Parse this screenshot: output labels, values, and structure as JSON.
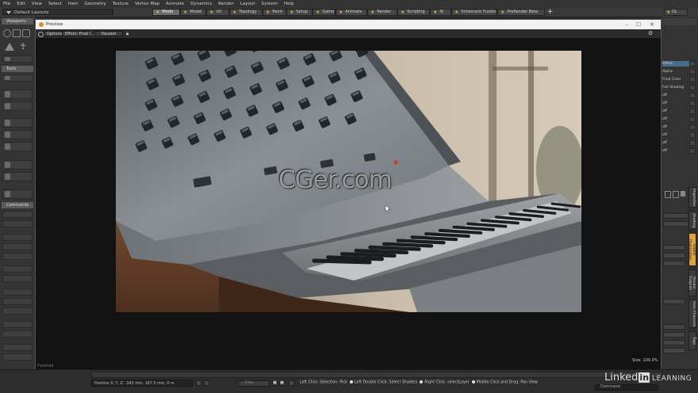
{
  "menu": [
    "File",
    "Edit",
    "View",
    "Select",
    "Item",
    "Geometry",
    "Texture",
    "Vertex Map",
    "Animate",
    "Dynamics",
    "Render",
    "Layout",
    "System",
    "Help"
  ],
  "layout_selector": "Default Layouts",
  "tabs": [
    {
      "label": "Modo",
      "active": true
    },
    {
      "label": "Model",
      "active": false
    },
    {
      "label": "UV",
      "active": false
    },
    {
      "label": "Topology",
      "active": false
    },
    {
      "label": "Paint",
      "active": false
    },
    {
      "label": "Setup",
      "active": false
    },
    {
      "label": "Game",
      "active": false
    },
    {
      "label": "Animate",
      "active": false
    },
    {
      "label": "Render",
      "active": false
    },
    {
      "label": "Scripting",
      "active": false
    },
    {
      "label": "IK",
      "active": false
    },
    {
      "label": "Schematic Fusion",
      "active": false
    },
    {
      "label": "ProRender Beta",
      "active": false
    }
  ],
  "tab_add": "+",
  "gl_button": "GL",
  "left_panel": {
    "viewports_label": "Viewports",
    "tools_label": "Tools",
    "commands_label": "Commands"
  },
  "right_panel": {
    "rows": [
      "Effect",
      "Alpha",
      "Final Color",
      "Full Shading",
      "off",
      "off",
      "off",
      "off",
      "off",
      "off",
      "off",
      "off"
    ],
    "vertical_tabs": [
      "Properties",
      "Shading",
      "Global Illumination",
      "Render Outputs",
      "Item Channels",
      "Tags"
    ]
  },
  "preview": {
    "title": "Preview",
    "toolbar": {
      "options": "Options",
      "effect": "Effect: Final C...",
      "status": "Paused"
    },
    "window_buttons": {
      "minimize": "–",
      "maximize": "☐",
      "close": "✕"
    },
    "size_label": "Size: 100.0%",
    "frame_label": "Finished"
  },
  "watermark": "CGer.com",
  "statusbar": {
    "position": "Position X, Y, Z:   -343 mm, 167.5 mm, 0 m",
    "slider_label": "Filter",
    "hints": [
      "Left Click: Selection: Pick",
      "Left Double Click: Select Shaders",
      "Right Click: selectLayer",
      "Middle Click and Drag: Pan View"
    ],
    "command_placeholder": "Command"
  },
  "branding": {
    "linked": "Linked",
    "in": "in",
    "learning": "LEARNING"
  },
  "colors": {
    "accent_star": "#e2b23a",
    "active_tab": "#6b6b6b",
    "highlight_tab": "#e2a23a"
  }
}
